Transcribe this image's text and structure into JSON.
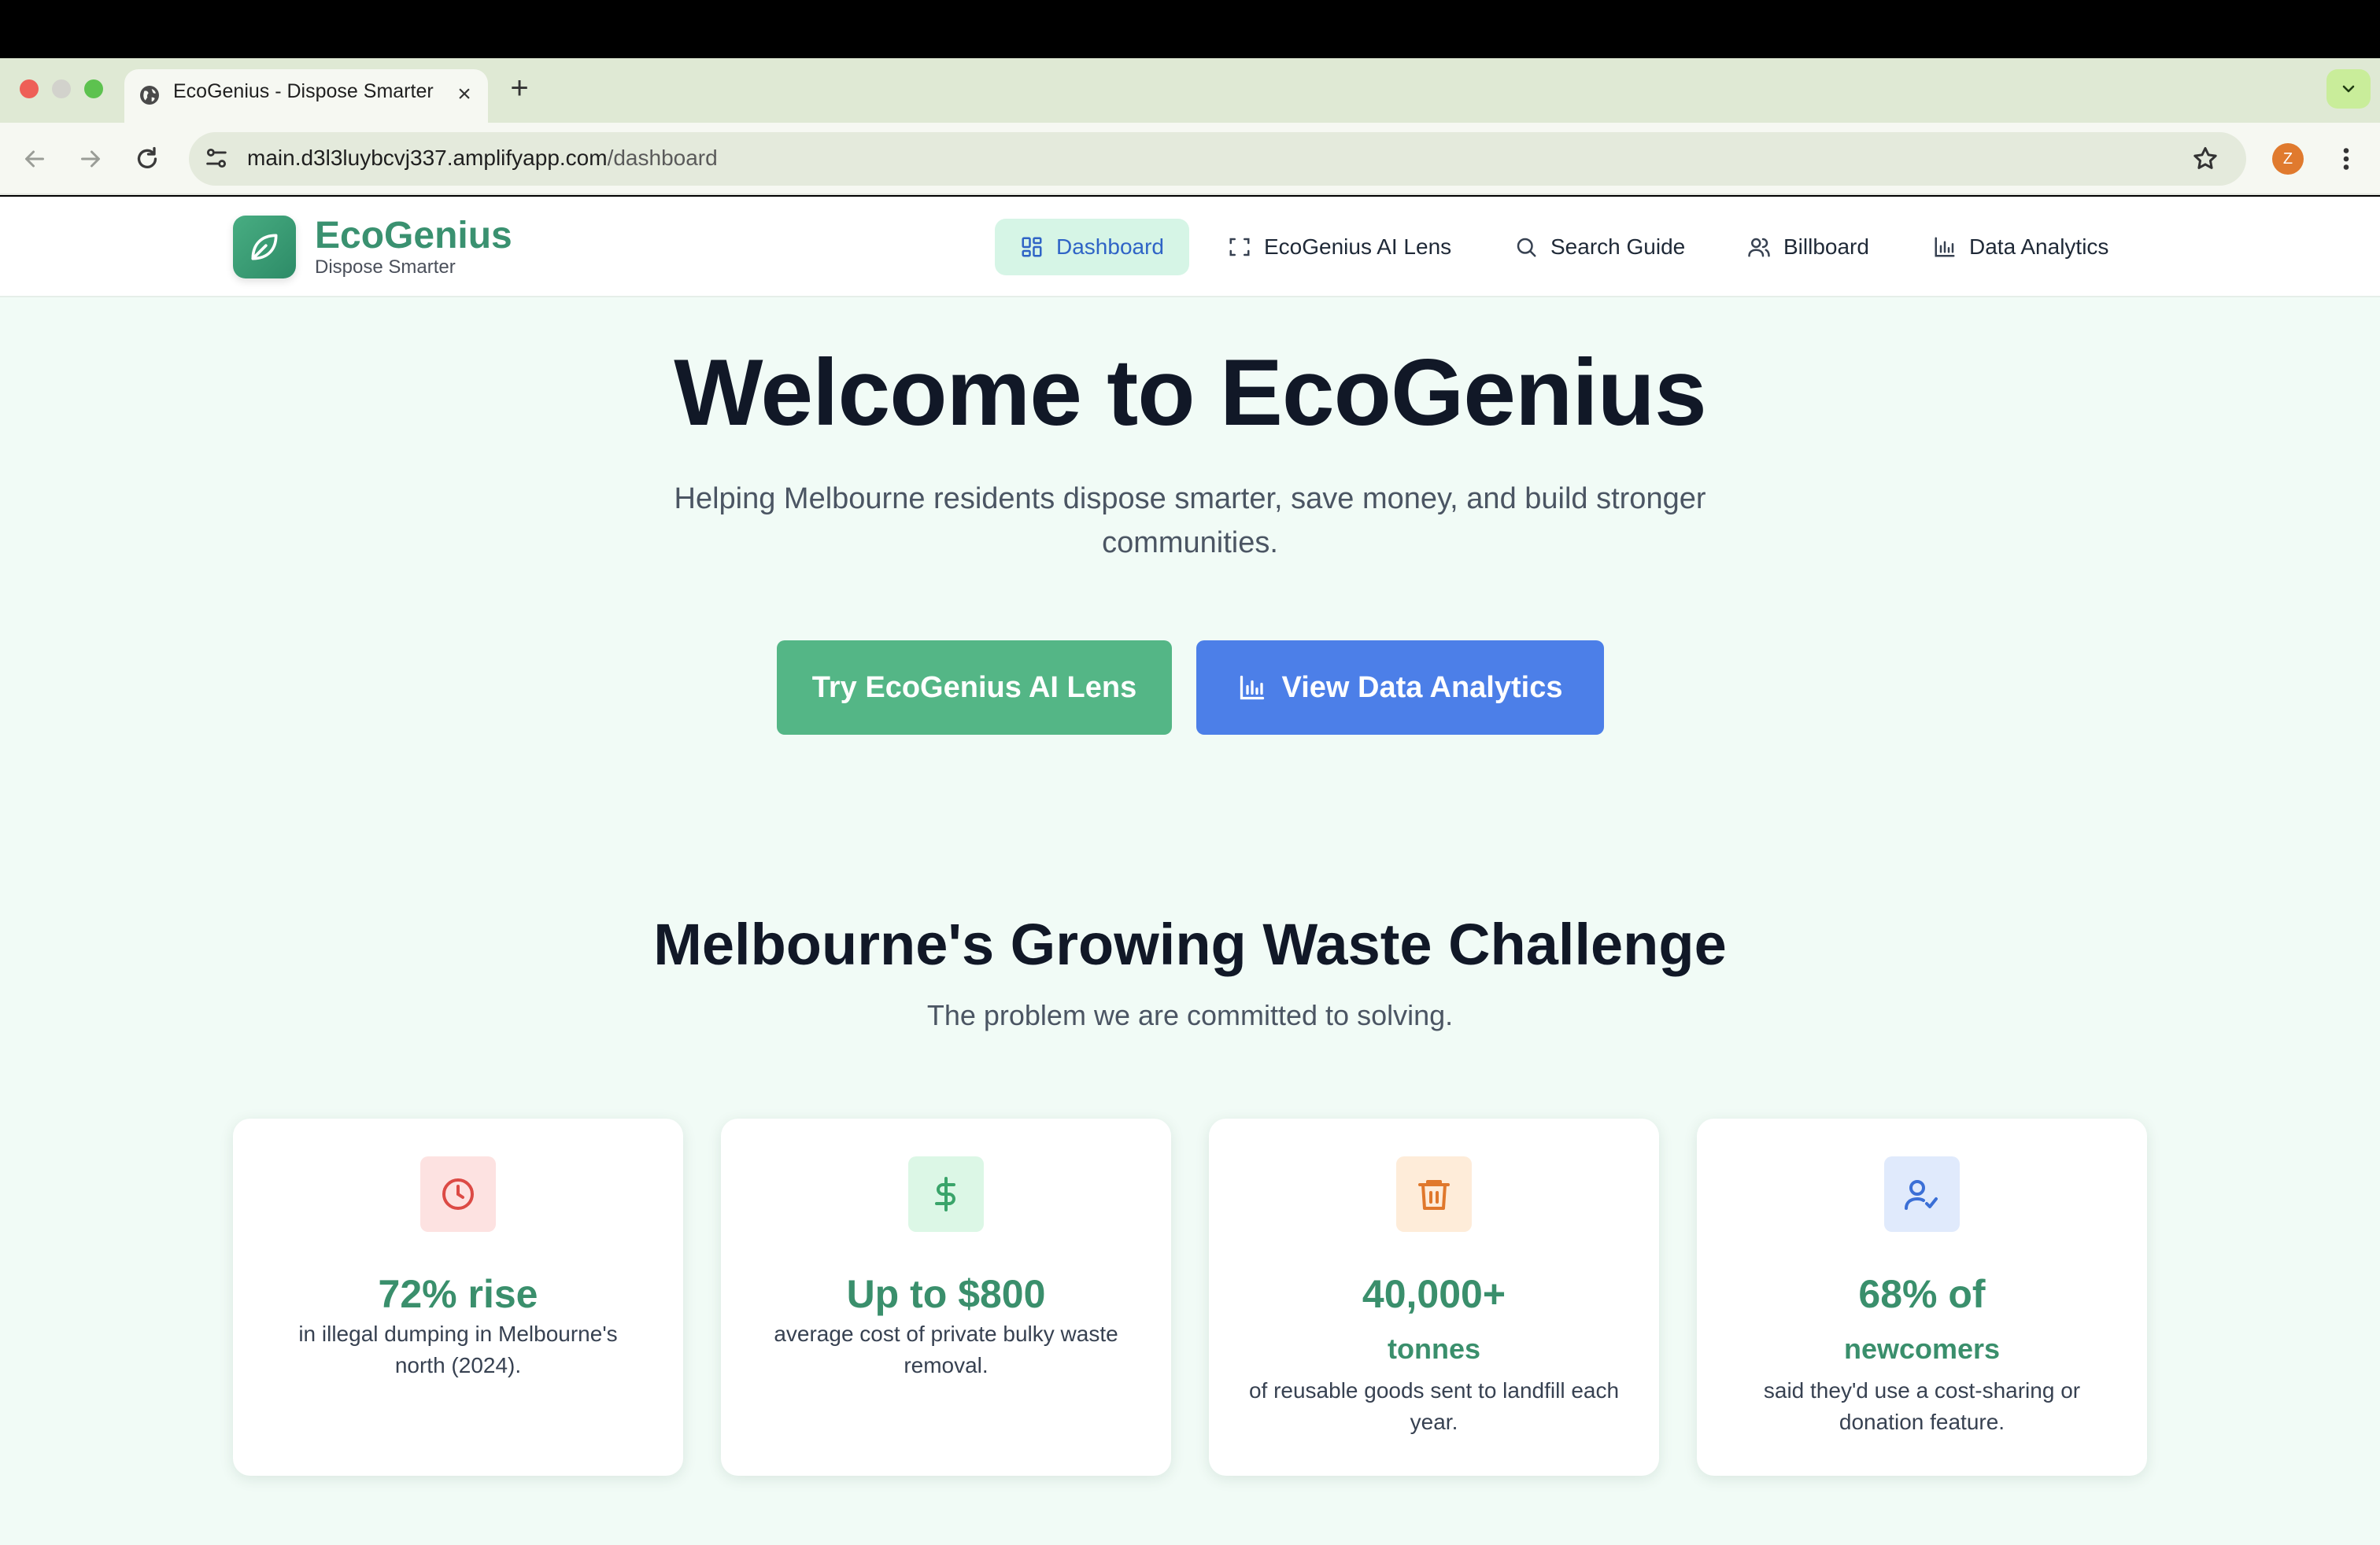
{
  "browser": {
    "tab_title": "EcoGenius - Dispose Smarter",
    "url_host": "main.d3l3luybcvj337.amplifyapp.com",
    "url_path": "/dashboard",
    "profile_initial": "Z",
    "new_tab_label": "+",
    "close_tab_label": "×"
  },
  "brand": {
    "name": "EcoGenius",
    "tagline": "Dispose Smarter",
    "color": "#3a9170"
  },
  "nav": {
    "items": [
      {
        "label": "Dashboard",
        "icon": "dashboard-grid-icon",
        "active": true
      },
      {
        "label": "EcoGenius AI Lens",
        "icon": "scan-frame-icon",
        "active": false
      },
      {
        "label": "Search Guide",
        "icon": "search-icon",
        "active": false
      },
      {
        "label": "Billboard",
        "icon": "users-icon",
        "active": false
      },
      {
        "label": "Data Analytics",
        "icon": "bar-chart-icon",
        "active": false
      }
    ]
  },
  "hero": {
    "title": "Welcome to EcoGenius",
    "subtitle": "Helping Melbourne residents dispose smarter, save money, and build stronger communities.",
    "primary_button": "Try EcoGenius AI Lens",
    "secondary_button": "View Data Analytics"
  },
  "challenge": {
    "title": "Melbourne's Growing Waste Challenge",
    "subtitle": "The problem we are committed to solving.",
    "cards": [
      {
        "icon": "clock-icon",
        "stat": "72% rise",
        "unit": "",
        "desc": "in illegal dumping in Melbourne's north (2024).",
        "icon_bg": "#fde2e1",
        "icon_color": "#dc4a45"
      },
      {
        "icon": "dollar-icon",
        "stat": "Up to $800",
        "unit": "",
        "desc": "average cost of private bulky waste removal.",
        "icon_bg": "#dcf7e6",
        "icon_color": "#3aa46a"
      },
      {
        "icon": "trash-icon",
        "stat": "40,000+",
        "unit": "tonnes",
        "desc": "of reusable goods sent to landfill each year.",
        "icon_bg": "#feecd9",
        "icon_color": "#e0782c"
      },
      {
        "icon": "user-check-icon",
        "stat": "68% of",
        "unit": "newcomers",
        "desc": "said they'd use a cost-sharing or donation feature.",
        "icon_bg": "#e0eafc",
        "icon_color": "#3b6fd6"
      }
    ]
  }
}
